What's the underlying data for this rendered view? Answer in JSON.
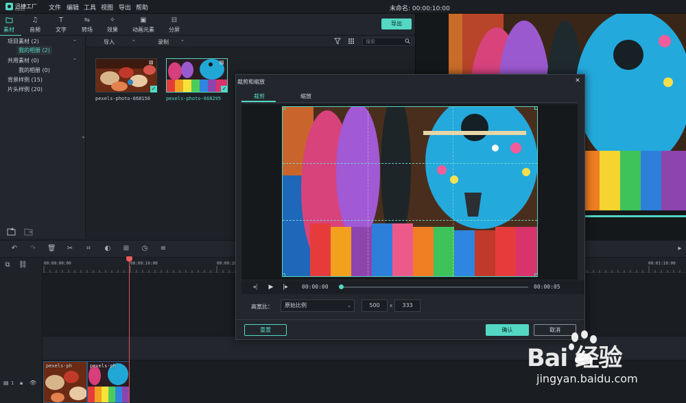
{
  "app": {
    "logo_text": "迅捷工厂",
    "logo_sub": "filmora",
    "project_title": "未命名: 00:00:10:00"
  },
  "menu": [
    "文件",
    "编辑",
    "工具",
    "视图",
    "导出",
    "帮助"
  ],
  "toolbar": {
    "tools": [
      {
        "label": "素材",
        "icon": "folder-icon"
      },
      {
        "label": "音频",
        "icon": "music-note-icon"
      },
      {
        "label": "文字",
        "icon": "text-icon"
      },
      {
        "label": "转场",
        "icon": "transition-icon"
      },
      {
        "label": "效果",
        "icon": "effects-icon"
      },
      {
        "label": "动画元素",
        "icon": "image-element-icon"
      },
      {
        "label": "分屏",
        "icon": "split-screen-icon"
      }
    ],
    "export_label": "导出"
  },
  "sidebar": {
    "items": [
      {
        "label": "项目素材 (2)"
      },
      {
        "label": "我的相册 (2)"
      },
      {
        "label": "共用素材 (0)"
      },
      {
        "label": "我的相册 (0)"
      },
      {
        "label": "背景样例 (15)"
      },
      {
        "label": "片头样例 (20)"
      }
    ]
  },
  "media_bar": {
    "import_label": "导入",
    "record_label": "录制",
    "search_placeholder": "搜索"
  },
  "media": [
    {
      "name": "pexels-photo-668156"
    },
    {
      "name": "pexels-photo-668295"
    }
  ],
  "timeline": {
    "timecodes": [
      "00:00:00:00",
      "00:00:10:00",
      "00:00:20:00",
      "00:01:10:00"
    ],
    "clips": [
      {
        "label": "pexels-ph"
      },
      {
        "label": "pexels-ph"
      }
    ],
    "track_number": "1"
  },
  "dialog": {
    "title": "裁剪和缩放",
    "tabs": [
      "裁剪",
      "缩放"
    ],
    "time_current": "00:00:00",
    "time_end": "00:00:05",
    "ratio_label": "高宽比：",
    "ratio_value": "原始比例",
    "width": "500",
    "height": "333",
    "times": "x",
    "reset_label": "重置",
    "ok_label": "确认",
    "cancel_label": "取消"
  },
  "watermark": {
    "brand": "Bai 经验",
    "url": "jingyan.baidu.com"
  },
  "colors": {
    "accent": "#54d8c4",
    "playhead": "#e05252",
    "clip_border": "#2d5a83"
  }
}
